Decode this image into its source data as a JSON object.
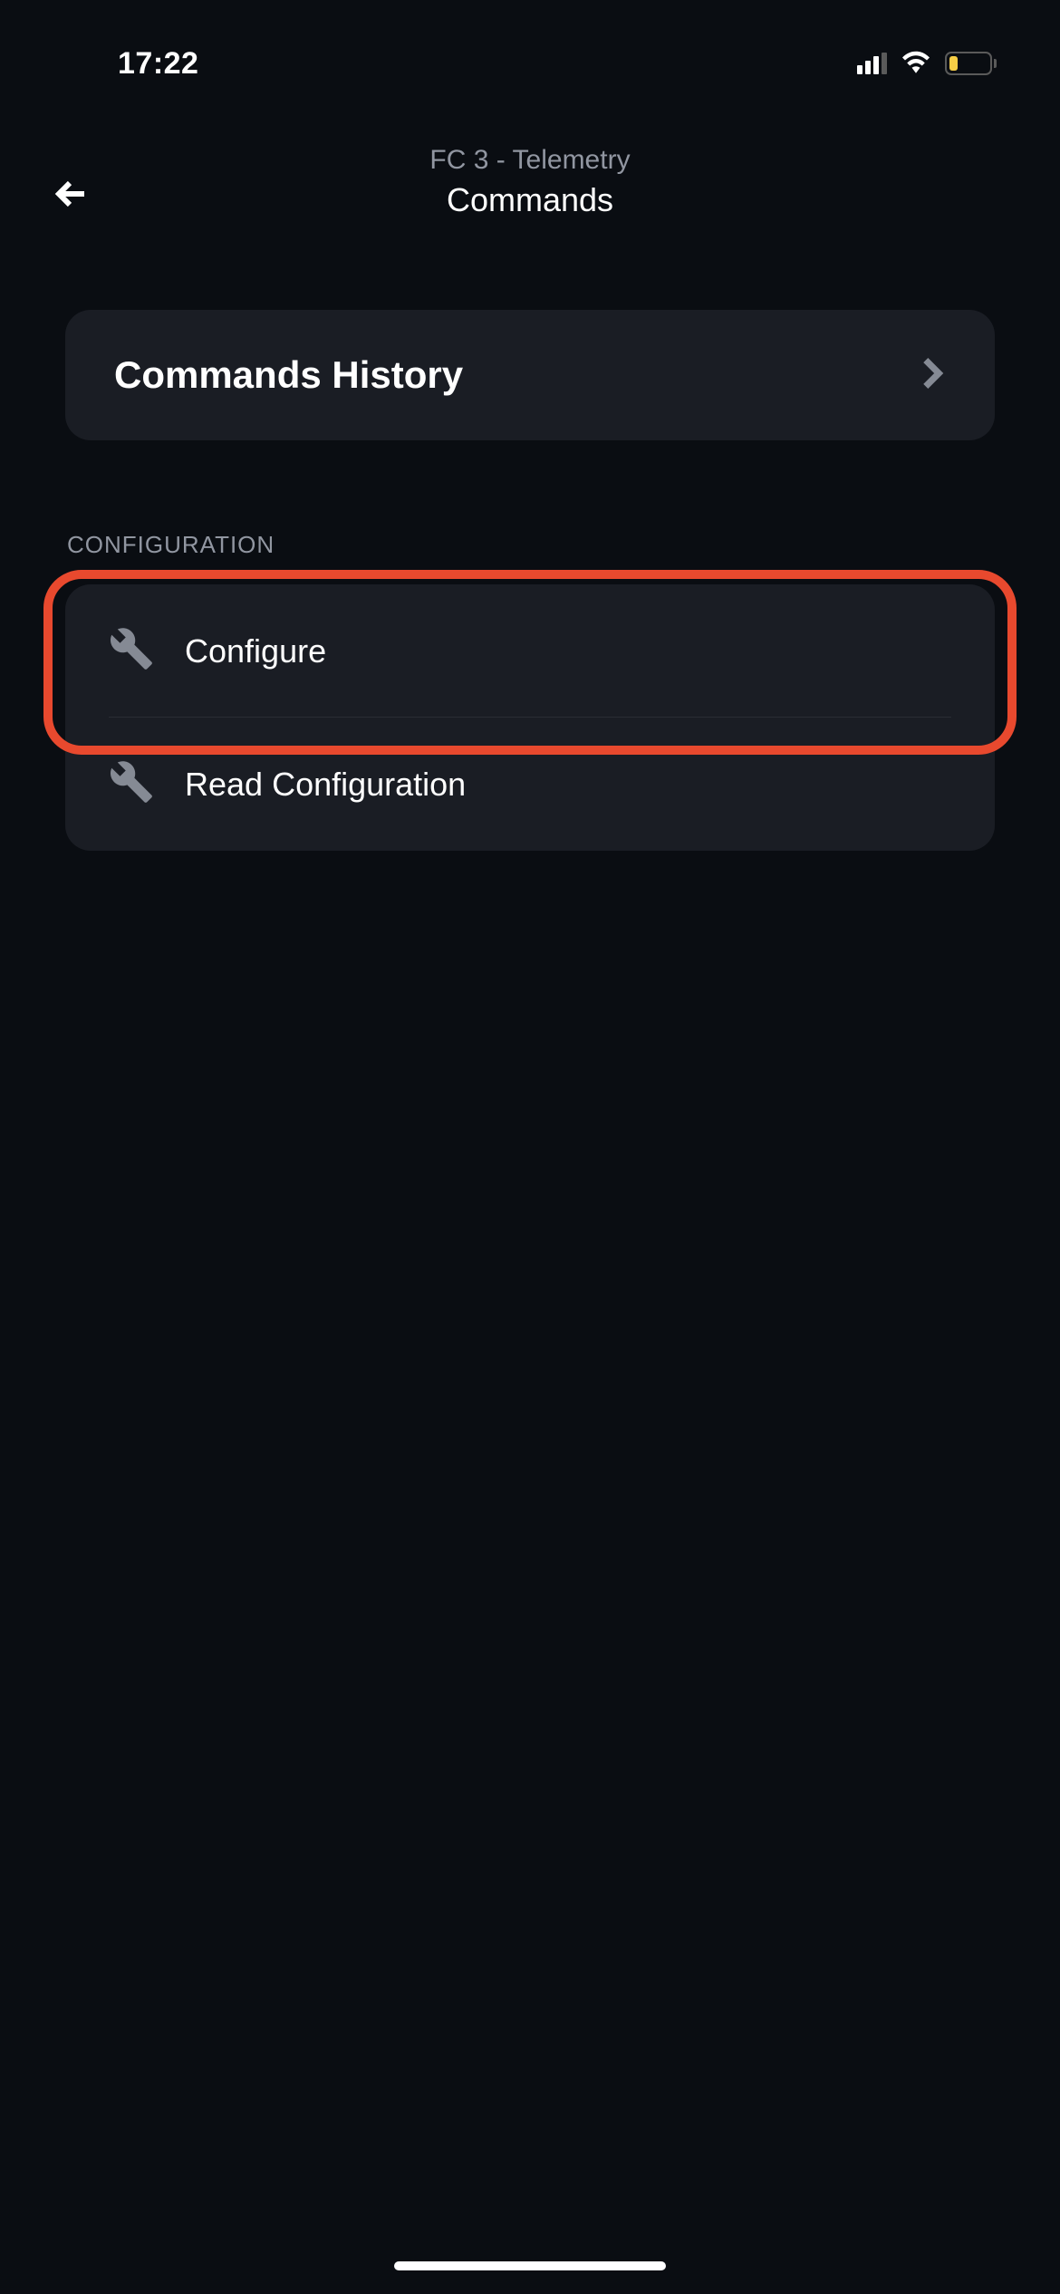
{
  "statusBar": {
    "time": "17:22"
  },
  "header": {
    "subtitle": "FC 3 - Telemetry",
    "title": "Commands"
  },
  "historyCard": {
    "title": "Commands History"
  },
  "configuration": {
    "sectionLabel": "CONFIGURATION",
    "items": [
      {
        "label": "Configure"
      },
      {
        "label": "Read Configuration"
      }
    ]
  }
}
